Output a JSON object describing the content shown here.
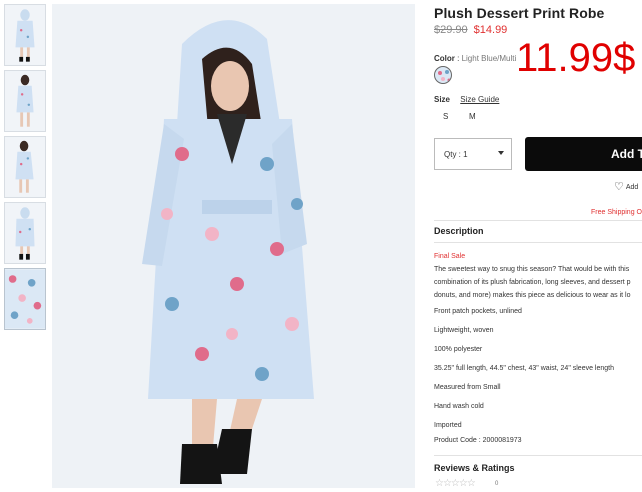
{
  "product": {
    "title": "Plush Dessert Print Robe",
    "old_price": "$29.90",
    "new_price": "$14.99",
    "overlay_price": "11.99$",
    "color_label": "Color",
    "color_value": "Light Blue/Multi",
    "size_label": "Size",
    "size_guide": "Size Guide",
    "sizes": [
      "S",
      "M"
    ],
    "qty_label": "Qty : 1",
    "add_button": "Add T",
    "wishlist": "Add",
    "free_shipping": "Free Shipping O"
  },
  "description": {
    "heading": "Description",
    "final_sale": "Final Sale",
    "lines": [
      "The sweetest way to snug this season? That would be with this",
      "combination of its plush fabrication, long sleeves, and dessert p",
      "donuts, and more) makes this piece as delicious to wear as it lo",
      "Front patch pockets, unlined",
      "Lightweight, woven",
      "100% polyester",
      "35.25\" full length, 44.5\" chest, 43\" waist, 24\" sleeve length",
      "Measured from Small",
      "Hand wash cold",
      "Imported",
      "Product Code : 2000081973"
    ]
  },
  "reviews": {
    "heading": "Reviews & Ratings",
    "stars": "☆☆☆☆☆",
    "count": "0"
  },
  "colors": {
    "price_red": "#e03131",
    "overlay_red": "#e00000",
    "robe_blue": "#cfe0f3",
    "button_black": "#0b0b0b"
  }
}
